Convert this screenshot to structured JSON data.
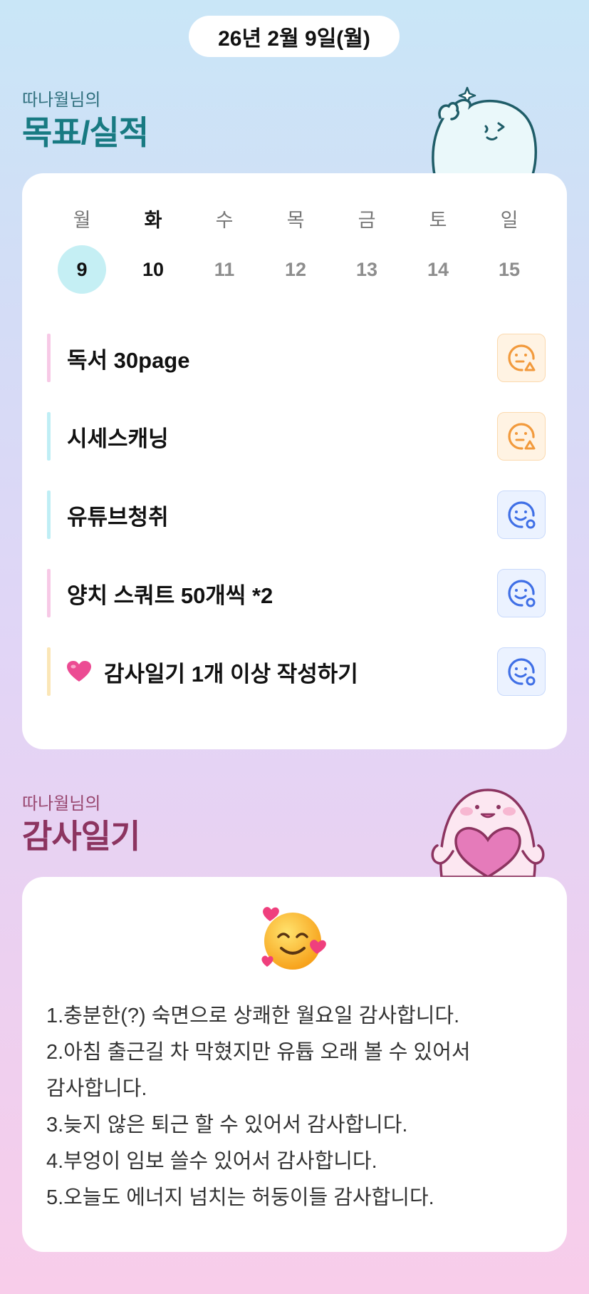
{
  "date_label": "26년 2월 9일(월)",
  "goal_section": {
    "subtitle": "따나월님의",
    "title": "목표/실적"
  },
  "week": {
    "days": [
      "월",
      "화",
      "수",
      "목",
      "금",
      "토",
      "일"
    ],
    "dates": [
      "9",
      "10",
      "11",
      "12",
      "13",
      "14",
      "15"
    ],
    "selected_index": 0
  },
  "goals": [
    {
      "label": "독서 30page",
      "bar_color": "#f7c9e6",
      "status": "partial",
      "status_icon": "face-triangle-icon"
    },
    {
      "label": "시세스캐닝",
      "bar_color": "#bfeef5",
      "status": "partial",
      "status_icon": "face-triangle-icon"
    },
    {
      "label": "유튜브청취",
      "bar_color": "#bfeef5",
      "status": "done",
      "status_icon": "face-circle-icon"
    },
    {
      "label": "양치 스쿼트 50개씩 *2",
      "bar_color": "#f7c9e6",
      "status": "done",
      "status_icon": "face-circle-icon"
    },
    {
      "label": "감사일기 1개 이상 작성하기",
      "bar_color": "#fbe6b6",
      "status": "done",
      "status_icon": "face-circle-icon",
      "prefix_icon": "heart-icon"
    }
  ],
  "thanks_section": {
    "subtitle": "따나월님의",
    "title": "감사일기"
  },
  "diary": {
    "mood_icon": "smiling-face-with-hearts-icon",
    "lines": [
      "1.충분한(?) 숙면으로 상쾌한 월요일 감사합니다.",
      "2.아침 출근길 차 막혔지만 유튭 오래 볼 수 있어서",
      "감사합니다.",
      "3.늦지 않은 퇴근 할 수 있어서 감사합니다.",
      "4.부엉이 임보 쓸수 있어서 감사합니다.",
      "5.오늘도 에너지 넘치는 허둥이들 감사합니다."
    ]
  },
  "colors": {
    "partial": "#f29a3c",
    "done": "#3f6fe6",
    "selected_day_bg": "#c5eff4",
    "goal_title": "#187a82",
    "thanks_title": "#8c3460"
  }
}
